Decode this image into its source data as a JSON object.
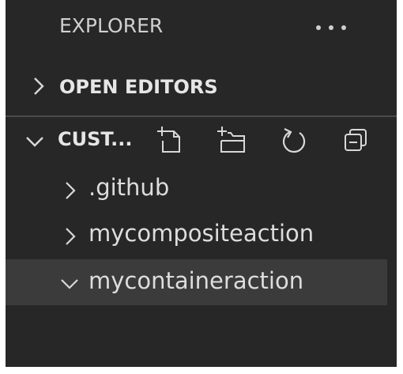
{
  "explorer": {
    "title": "EXPLORER",
    "more_icon": "ellipsis-icon"
  },
  "sections": {
    "open_editors": {
      "label": "OPEN EDITORS",
      "expanded": false
    },
    "folder": {
      "label": "CUST...",
      "expanded": true,
      "actions": [
        {
          "name": "new-file",
          "icon": "new-file-icon"
        },
        {
          "name": "new-folder",
          "icon": "new-folder-icon"
        },
        {
          "name": "refresh",
          "icon": "refresh-icon"
        },
        {
          "name": "collapse-all",
          "icon": "collapse-all-icon"
        }
      ]
    }
  },
  "tree": {
    "items": [
      {
        "label": ".github",
        "expanded": false
      },
      {
        "label": "mycompositeaction",
        "expanded": false
      },
      {
        "label": "mycontaineraction",
        "expanded": true,
        "selected": true
      }
    ]
  },
  "colors": {
    "background": "#272727",
    "selection": "#3b3b3b",
    "text": "#dddddd"
  }
}
